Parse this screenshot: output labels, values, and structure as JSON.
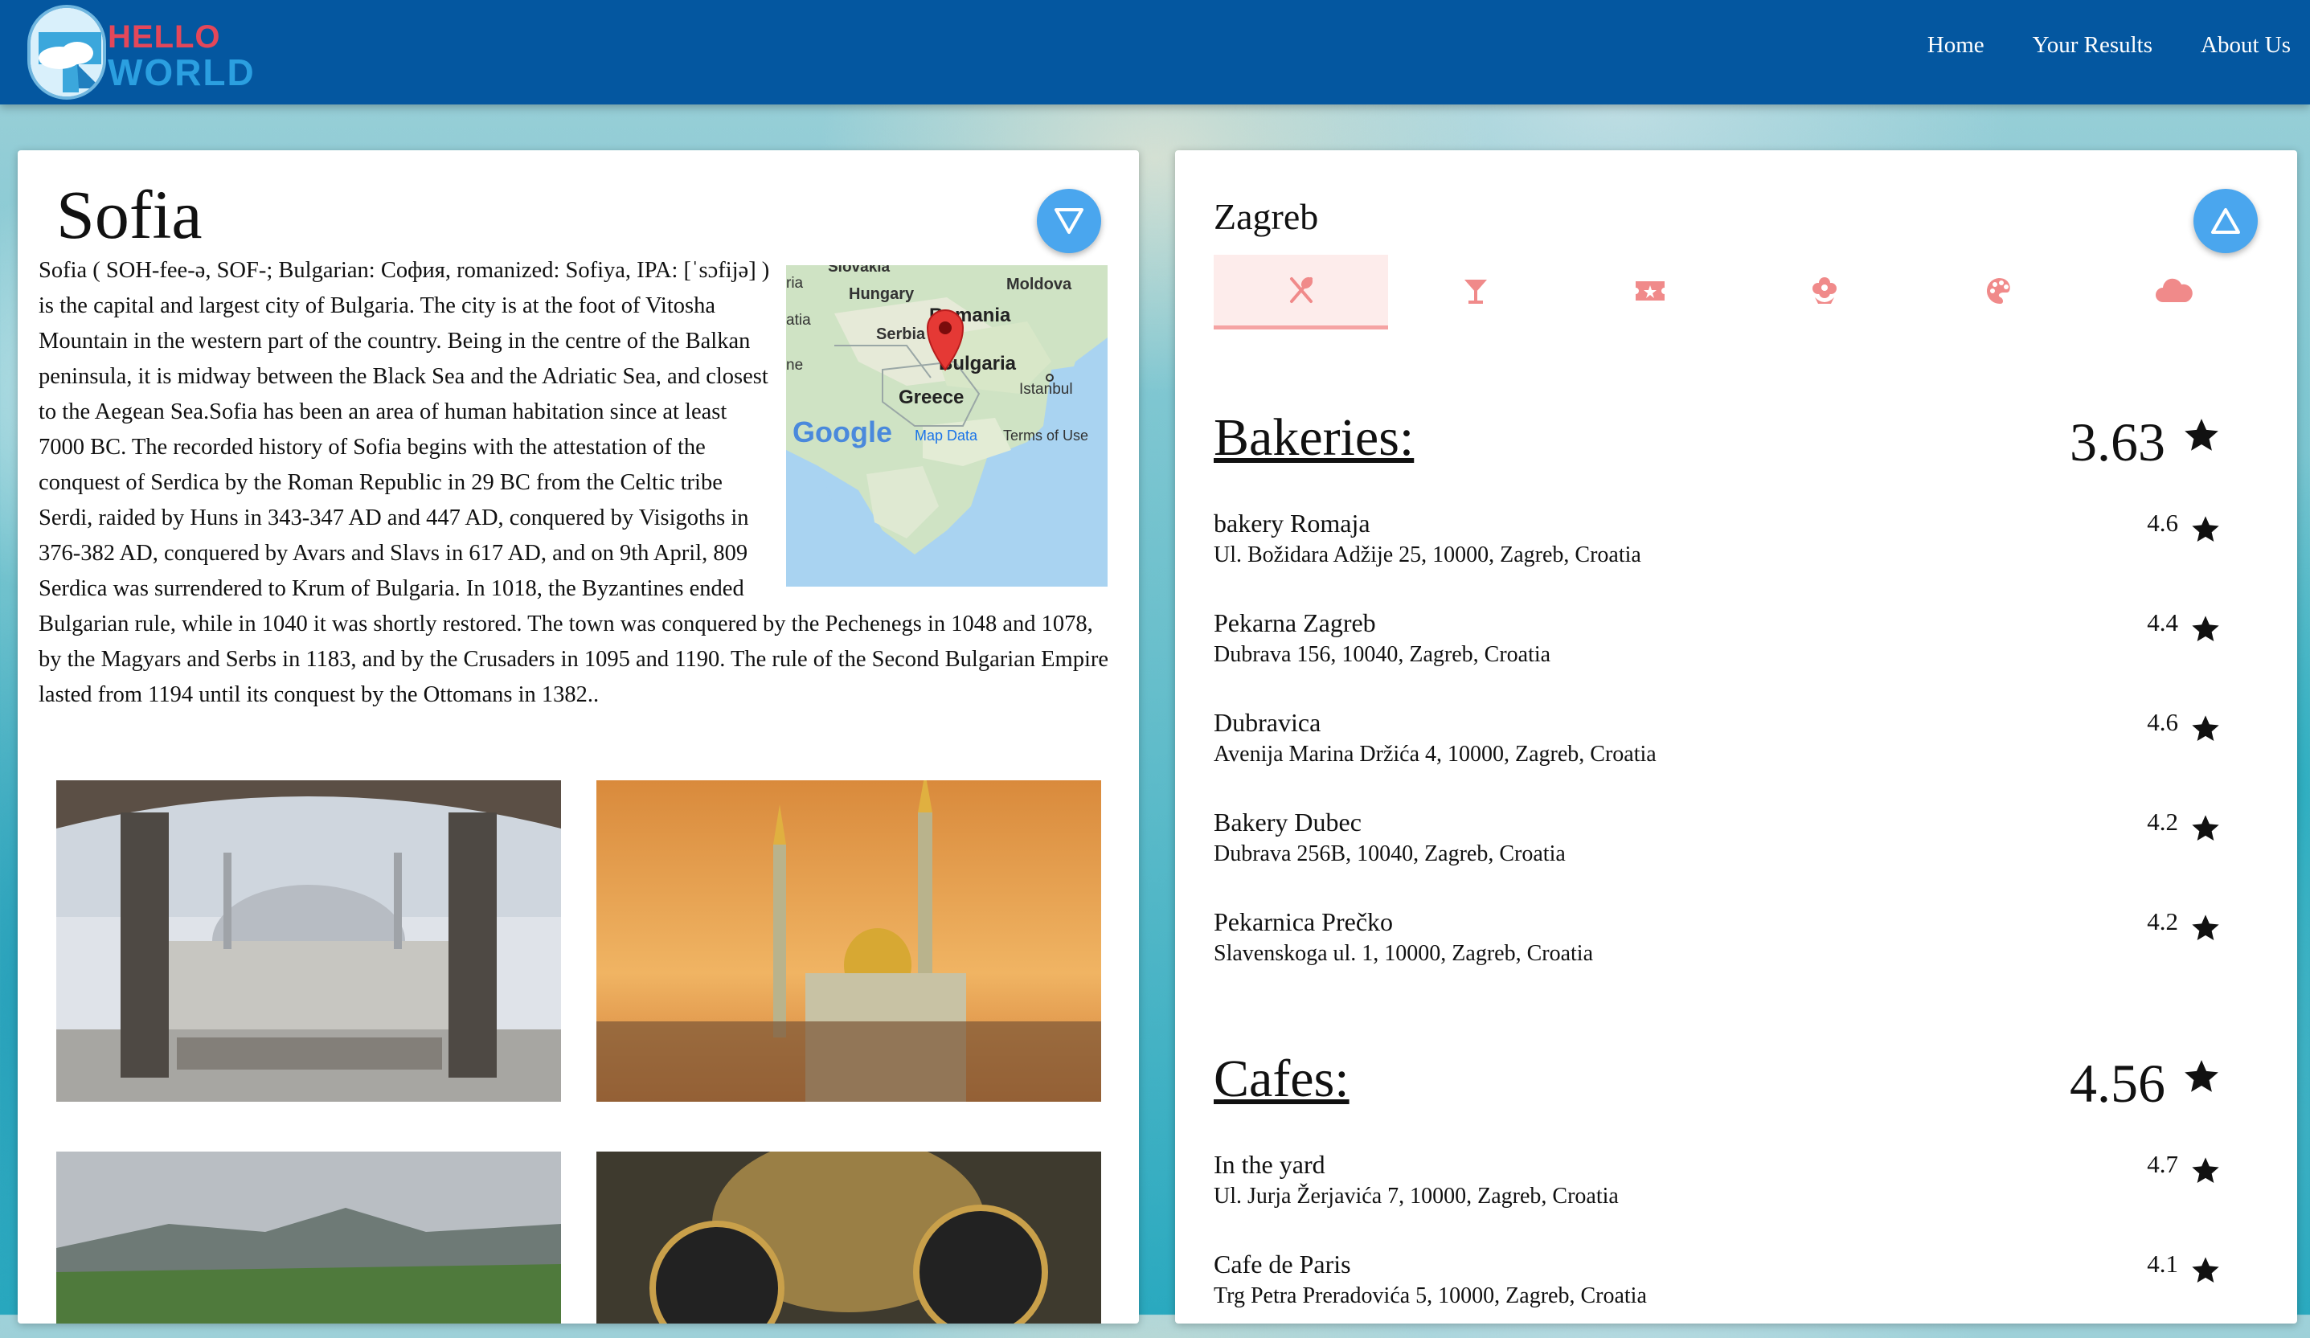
{
  "header": {
    "logo_line1": "HELLO",
    "logo_line2": "WORLD",
    "nav": [
      "Home",
      "Your Results",
      "About Us"
    ]
  },
  "left": {
    "city": "Sofia",
    "description": "Sofia ( SOH-fee-ə, SOF-; Bulgarian: София, romanized: Sofiya, IPA: [ˈsɔfijə] ) is the capital and largest city of Bulgaria. The city is at the foot of Vitosha Mountain in the western part of the country. Being in the centre of the Balkan peninsula, it is midway between the Black Sea and the Adriatic Sea, and closest to the Aegean Sea.Sofia has been an area of human habitation since at least 7000 BC. The recorded history of Sofia begins with the attestation of the conquest of Serdica by the Roman Republic in 29 BC from the Celtic tribe Serdi, raided by Huns in 343-347 AD and 447 AD, conquered by Visigoths in 376-382 AD, conquered by Avars and Slavs in 617 AD, and on 9th April, 809 Serdica was surrendered to Krum of Bulgaria. In 1018, the Byzantines ended Bulgarian rule, while in 1040 it was shortly restored. The town was conquered by the Pechenegs in 1048 and 1078, by the Magyars and Serbs in 1183, and by the Crusaders in 1095 and 1190. The rule of the Second Bulgarian Empire lasted from 1194 until its conquest by the Ottomans in 1382..",
    "map": {
      "labels": {
        "slovakia": "Slovakia",
        "hungary": "Hungary",
        "moldova": "Moldova",
        "romania": "Romania",
        "serbia": "Serbia",
        "bulgaria": "Bulgaria",
        "istanbul": "Istanbul",
        "greece": "Greece",
        "croatia_frag": "atia",
        "austria_frag": "ria",
        "italy_frag": "ne"
      },
      "google": "Google",
      "map_data": "Map Data",
      "terms": "Terms of Use"
    }
  },
  "right": {
    "city": "Zagreb",
    "tabs": [
      "restaurant-icon",
      "cocktail-icon",
      "ticket-icon",
      "flower-icon",
      "palette-icon",
      "cloud-icon"
    ],
    "accent": "#f08a8a",
    "sections": [
      {
        "title": "Bakeries:",
        "score": "3.63",
        "places": [
          {
            "name": "bakery Romaja",
            "address": "Ul. Božidara Adžije 25, 10000, Zagreb, Croatia",
            "rating": "4.6"
          },
          {
            "name": "Pekarna Zagreb",
            "address": "Dubrava 156, 10040, Zagreb, Croatia",
            "rating": "4.4"
          },
          {
            "name": "Dubravica",
            "address": "Avenija Marina Držića 4, 10000, Zagreb, Croatia",
            "rating": "4.6"
          },
          {
            "name": "Bakery Dubec",
            "address": "Dubrava 256B, 10040, Zagreb, Croatia",
            "rating": "4.2"
          },
          {
            "name": "Pekarnica Prečko",
            "address": "Slavenskoga ul. 1, 10000, Zagreb, Croatia",
            "rating": "4.2"
          }
        ]
      },
      {
        "title": "Cafes:",
        "score": "4.56",
        "places": [
          {
            "name": "In the yard",
            "address": "Ul. Jurja Žerjavića 7, 10000, Zagreb, Croatia",
            "rating": "4.7"
          },
          {
            "name": "Cafe de Paris",
            "address": "Trg Petra Preradovića 5, 10000, Zagreb, Croatia",
            "rating": "4.1"
          }
        ]
      }
    ]
  }
}
